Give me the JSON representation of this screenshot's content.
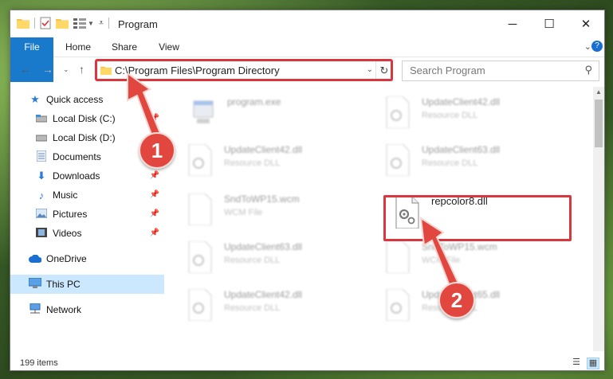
{
  "window": {
    "title": "Program",
    "minimize": "─",
    "maximize": "☐",
    "close": "✕"
  },
  "ribbon": {
    "tabs": [
      "File",
      "Home",
      "Share",
      "View"
    ],
    "help": "?"
  },
  "address": {
    "path": "C:\\Program Files\\Program Directory",
    "search_placeholder": "Search Program"
  },
  "sidebar": {
    "items": [
      {
        "label": "Quick access",
        "icon": "star-icon",
        "pinned": false
      },
      {
        "label": "Local Disk (C:)",
        "icon": "drive-icon",
        "pinned": true
      },
      {
        "label": "Local Disk (D:)",
        "icon": "drive-icon",
        "pinned": false
      },
      {
        "label": "Documents",
        "icon": "documents-icon",
        "pinned": false
      },
      {
        "label": "Downloads",
        "icon": "download-icon",
        "pinned": true
      },
      {
        "label": "Music",
        "icon": "music-icon",
        "pinned": true
      },
      {
        "label": "Pictures",
        "icon": "pictures-icon",
        "pinned": true
      },
      {
        "label": "Videos",
        "icon": "videos-icon",
        "pinned": true
      },
      {
        "label": "OneDrive",
        "icon": "cloud-icon",
        "pinned": false
      },
      {
        "label": "This PC",
        "icon": "computer-icon",
        "pinned": false
      },
      {
        "label": "Network",
        "icon": "network-icon",
        "pinned": false
      }
    ]
  },
  "files": [
    {
      "name": "program.exe",
      "desc": ""
    },
    {
      "name": "UpdateClient42.dll",
      "desc": "Resource DLL"
    },
    {
      "name": "UpdateClient42.dll",
      "desc": "Resource DLL"
    },
    {
      "name": "UpdateClient63.dll",
      "desc": "Resource DLL"
    },
    {
      "name": "SndToWP15.wcm",
      "desc": "WCM File"
    },
    {
      "name": "repcolor8.dll",
      "desc": ""
    },
    {
      "name": "UpdateClient63.dll",
      "desc": "Resource DLL"
    },
    {
      "name": "SndToWP15.wcm",
      "desc": "WCM File"
    },
    {
      "name": "UpdateClient42.dll",
      "desc": "Resource DLL"
    },
    {
      "name": "UpdateClient65.dll",
      "desc": "Resource DLL"
    }
  ],
  "status": {
    "count": "199 items"
  },
  "callouts": [
    "1",
    "2"
  ],
  "colors": {
    "accent": "#1979ca",
    "highlight": "#d9363e",
    "selected": "#cce8ff"
  }
}
